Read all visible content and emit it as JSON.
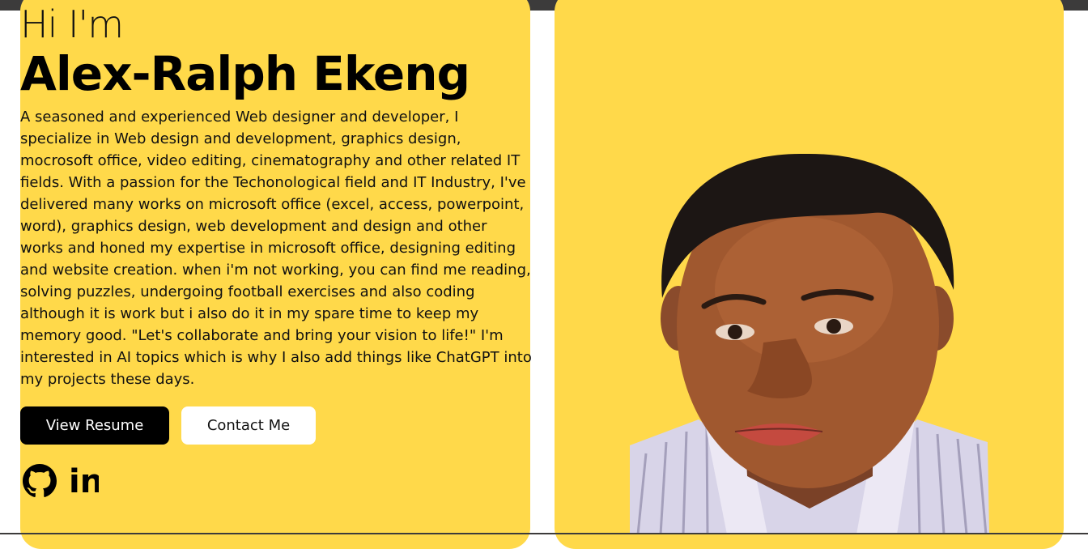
{
  "hero": {
    "greeting": "Hi I'm",
    "name": "Alex-Ralph Ekeng",
    "bio": "A seasoned and experienced Web designer and developer, I specialize in Web design and development, graphics design, mocrosoft office, video editing, cinematography and other related IT fields. With a passion for the Techonological field and IT Industry, I've delivered many works on microsoft office (excel, access, powerpoint, word), graphics design, web development and design and other works and honed my expertise in microsoft office, designing editing and website creation. when i'm not working, you can find me reading, solving puzzles, undergoing football exercises and also coding although it is work but i also do it in my spare time to keep my memory good. \"Let's collaborate and bring your vision to life!\" I'm interested in AI topics which is why I also add things like ChatGPT into my projects these days.",
    "buttons": {
      "resume_label": "View Resume",
      "contact_label": "Contact Me"
    },
    "social": {
      "github_icon": "github-icon",
      "linkedin_icon": "linkedin-icon",
      "linkedin_text": "in"
    }
  },
  "portrait": {
    "icon": "profile-photo"
  },
  "colors": {
    "card_background": "#ffd94a",
    "top_bar": "#3c3b3b",
    "primary_button": "#000000",
    "secondary_button": "#ffffff"
  }
}
